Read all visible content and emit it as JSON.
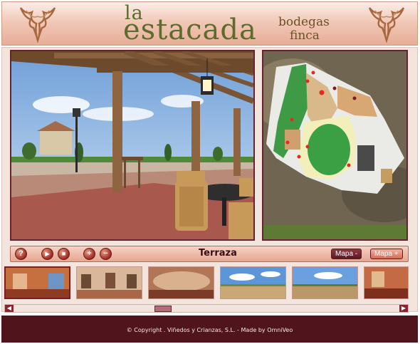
{
  "header": {
    "brand_line1": "la",
    "brand_line2": "estacada",
    "brand_sub1": "bodegas",
    "brand_sub2": "finca"
  },
  "toolbar": {
    "help_label": "?",
    "play_label": "▶",
    "stop_label": "■",
    "zoom_in_label": "+",
    "zoom_out_label": "−",
    "scene_title": "Terraza",
    "map_minus_label": "Mapa -",
    "map_plus_label": "Mapa +"
  },
  "thumbnails": {
    "selected_index": 0
  },
  "footer": {
    "copyright": "© Copyright . Viñedos y Crianzas, S.L. - Made by OmniVeo"
  },
  "colors": {
    "accent": "#6b2230",
    "footer_bg": "#50141c",
    "header_bg": "#f1c9b8"
  }
}
